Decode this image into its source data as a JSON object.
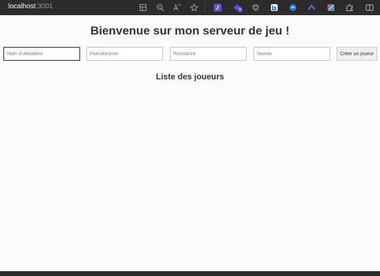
{
  "browser": {
    "url_host": "localhost",
    "url_port": ":3001",
    "extension_badge": "6"
  },
  "page": {
    "title": "Bienvenue sur mon serveur de jeu !",
    "form": {
      "username_placeholder": "Nom d'utilisateur",
      "pseudo_placeholder": "Pseudonyme",
      "power_placeholder": "Puissance",
      "level_placeholder": "Niveau",
      "create_button_label": "Créer un joueur"
    },
    "players_title": "Liste des joueurs"
  },
  "colors": {
    "toolbar": "#2b2b2b",
    "page_background": "#fbfbfb",
    "heading": "#333333",
    "extension_purple": "#5b4bd6"
  }
}
